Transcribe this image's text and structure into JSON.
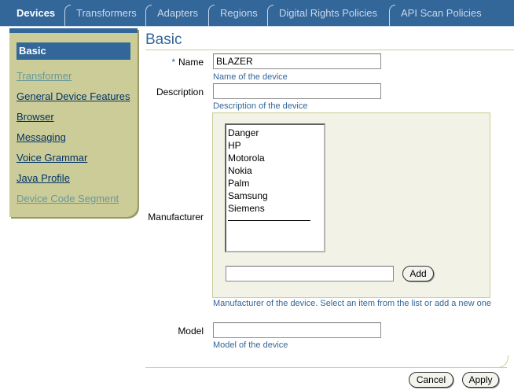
{
  "tabs": [
    {
      "label": "Devices",
      "active": true
    },
    {
      "label": "Transformers",
      "active": false
    },
    {
      "label": "Adapters",
      "active": false
    },
    {
      "label": "Regions",
      "active": false
    },
    {
      "label": "Digital Rights Policies",
      "active": false
    },
    {
      "label": "API Scan Policies",
      "active": false
    }
  ],
  "sidenav": {
    "active": "Basic",
    "links": [
      {
        "label": "Transformer",
        "visited": true
      },
      {
        "label": "General Device Features",
        "visited": false
      },
      {
        "label": "Browser",
        "visited": false
      },
      {
        "label": "Messaging",
        "visited": false
      },
      {
        "label": "Voice Grammar",
        "visited": false
      },
      {
        "label": "Java Profile",
        "visited": false
      },
      {
        "label": "Device Code Segment",
        "visited": true
      }
    ]
  },
  "page_title": "Basic",
  "form": {
    "name": {
      "required_mark": "*",
      "label": "Name",
      "value": "BLAZER",
      "hint": "Name of the device"
    },
    "description": {
      "label": "Description",
      "value": "",
      "hint": "Description of the device"
    },
    "manufacturer": {
      "label": "Manufacturer",
      "options": [
        "Danger",
        "HP",
        "Motorola",
        "Nokia",
        "Palm",
        "Samsung",
        "Siemens"
      ],
      "new_value": "",
      "add_label": "Add",
      "hint": "Manufacturer of the device. Select an item from the list or add a new one"
    },
    "model": {
      "label": "Model",
      "value": "",
      "hint": "Model of the device"
    }
  },
  "buttons": {
    "cancel": "Cancel",
    "apply": "Apply"
  },
  "colors": {
    "brand_blue": "#336699",
    "tan": "#cccc99",
    "hint_blue": "#336699"
  }
}
